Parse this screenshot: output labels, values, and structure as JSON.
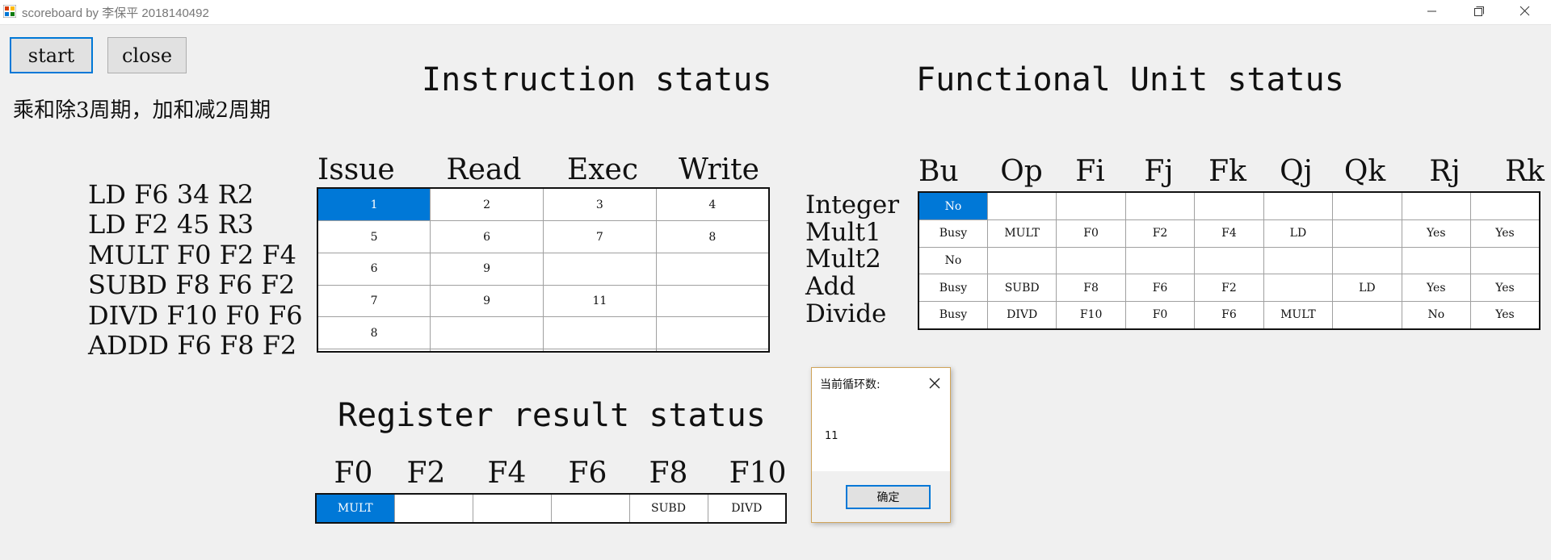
{
  "window": {
    "title": "scoreboard by 李保平 2018140492"
  },
  "toolbar": {
    "start_label": "start",
    "close_label": "close"
  },
  "note": "乘和除3周期，加和减2周期",
  "instruction_status": {
    "heading": "Instruction status",
    "columns": [
      "Issue",
      "Read",
      "Exec",
      "Write"
    ],
    "instructions": [
      "LD F6 34 R2",
      "LD F2 45 R3",
      "MULT F0 F2 F4",
      "SUBD F8 F6 F2",
      "DIVD F10 F0 F6",
      "ADDD F6 F8 F2"
    ],
    "rows": [
      [
        "1",
        "2",
        "3",
        "4"
      ],
      [
        "5",
        "6",
        "7",
        "8"
      ],
      [
        "6",
        "9",
        "",
        ""
      ],
      [
        "7",
        "9",
        "11",
        ""
      ],
      [
        "8",
        "",
        "",
        ""
      ],
      [
        "",
        "",
        "",
        ""
      ]
    ]
  },
  "functional_unit_status": {
    "heading": "Functional Unit status",
    "columns": [
      "Bu",
      "Op",
      "Fi",
      "Fj",
      "Fk",
      "Qj",
      "Qk",
      "Rj",
      "Rk"
    ],
    "units": [
      "Integer",
      "Mult1",
      "Mult2",
      "Add",
      "Divide"
    ],
    "rows": [
      [
        "No",
        "",
        "",
        "",
        "",
        "",
        "",
        "",
        ""
      ],
      [
        "Busy",
        "MULT",
        "F0",
        "F2",
        "F4",
        "LD",
        "",
        "Yes",
        "Yes"
      ],
      [
        "No",
        "",
        "",
        "",
        "",
        "",
        "",
        "",
        ""
      ],
      [
        "Busy",
        "SUBD",
        "F8",
        "F6",
        "F2",
        "",
        "LD",
        "Yes",
        "Yes"
      ],
      [
        "Busy",
        "DIVD",
        "F10",
        "F0",
        "F6",
        "MULT",
        "",
        "No",
        "Yes"
      ]
    ]
  },
  "register_result_status": {
    "heading": "Register result status",
    "columns": [
      "F0",
      "F2",
      "F4",
      "F6",
      "F8",
      "F10"
    ],
    "values": [
      "MULT",
      "",
      "",
      "",
      "SUBD",
      "DIVD"
    ]
  },
  "dialog": {
    "title": "当前循环数:",
    "message": "11",
    "ok_label": "确定"
  },
  "colors": {
    "accent": "#0078d7",
    "background": "#f0f0f0",
    "dialog_border": "#d0a45a"
  }
}
